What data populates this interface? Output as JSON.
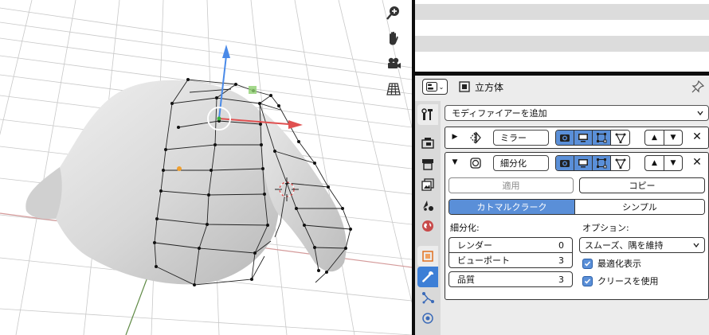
{
  "viewport_tools": [
    "zoom-icon",
    "hand-pan-icon",
    "camera-icon",
    "grid-icon"
  ],
  "properties": {
    "header": {
      "object_name": "立方体"
    },
    "tabs": [
      "tool-icon",
      "render-icon",
      "output-icon",
      "view-layer-icon",
      "scene-icon",
      "world-icon",
      "object-icon",
      "modifier-wrench-icon",
      "particles-icon",
      "physics-icon"
    ],
    "add_modifier_label": "モディファイアーを追加",
    "mirror": {
      "name": "ミラー",
      "expanded": false
    },
    "subsurf": {
      "name": "細分化",
      "expanded": true,
      "apply_label": "適用",
      "copy_label": "コピー",
      "algo_catmull": "カトマルクラーク",
      "algo_simple": "シンプル",
      "subdiv_heading": "細分化:",
      "render_label": "レンダー",
      "render_value": "0",
      "viewport_label": "ビューポート",
      "viewport_value": "3",
      "quality_label": "品質",
      "quality_value": "3",
      "options_heading": "オプション:",
      "uv_smooth": "スムーズ、隅を維持",
      "optimal_display": "最適化表示",
      "use_creases": "クリースを使用"
    }
  },
  "colors": {
    "accent": "#5a8fd8",
    "active_tab": "#3d7fd6",
    "panel_bg": "#ececec",
    "axis_red": "#e05050",
    "axis_green": "#7ab24a",
    "axis_blue": "#4a8ae8"
  }
}
